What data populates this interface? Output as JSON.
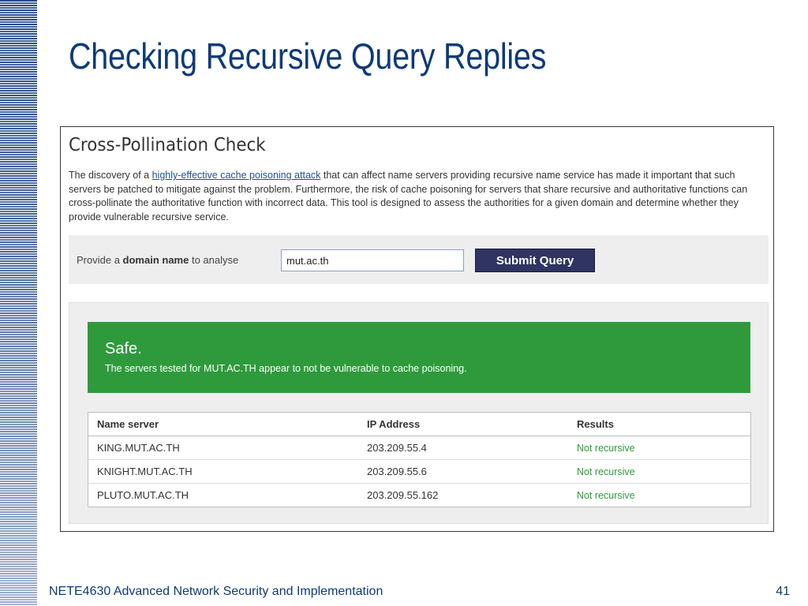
{
  "slide": {
    "title": "Checking Recursive Query Replies",
    "footer": "NETE4630 Advanced Network Security and Implementation",
    "page_number": "41"
  },
  "check": {
    "title": "Cross-Pollination Check",
    "intro_before_link": "The discovery of a ",
    "intro_link": "highly-effective cache poisoning attack",
    "intro_after_link": " that can affect name servers providing recursive name service has made it important that such servers be patched to mitigate against the problem. Furthermore, the risk of cache poisoning for servers that share recursive and authoritative functions can cross-pollinate the authoritative function with incorrect data. This tool is designed to assess the authorities for a given domain and determine whether they provide vulnerable recursive service."
  },
  "form": {
    "label_before": "Provide a ",
    "label_bold": "domain name",
    "label_after": " to analyse",
    "input_value": "mut.ac.th",
    "submit_label": "Submit Query"
  },
  "result": {
    "status": "Safe.",
    "message": "The servers tested for MUT.AC.TH appear to not be vulnerable to cache poisoning.",
    "status_color": "#2f9a3c"
  },
  "table": {
    "headers": [
      "Name server",
      "IP Address",
      "Results"
    ],
    "rows": [
      [
        "KING.MUT.AC.TH",
        "203.209.55.4",
        "Not recursive"
      ],
      [
        "KNIGHT.MUT.AC.TH",
        "203.209.55.6",
        "Not recursive"
      ],
      [
        "PLUTO.MUT.AC.TH",
        "203.209.55.162",
        "Not recursive"
      ]
    ]
  },
  "colors": {
    "title_blue": "#0e3a78",
    "button_navy": "#2f3462",
    "safe_green": "#2f9a3c"
  }
}
